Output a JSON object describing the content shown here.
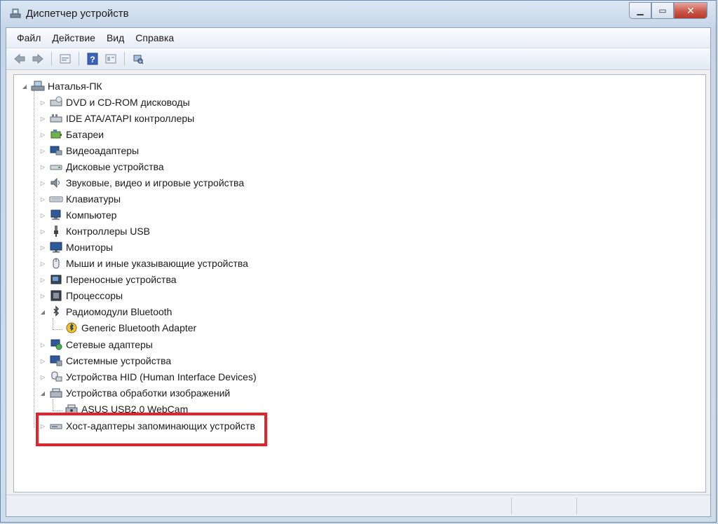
{
  "window": {
    "title": "Диспетчер устройств",
    "minimize_glyph": "▁",
    "maximize_glyph": "▭",
    "close_glyph": "✕"
  },
  "menu": {
    "items": [
      "Файл",
      "Действие",
      "Вид",
      "Справка"
    ]
  },
  "toolbar": {
    "buttons": [
      "back-arrow-icon",
      "forward-arrow-icon",
      "properties-icon",
      "help-icon",
      "view-icon",
      "scan-hardware-icon"
    ]
  },
  "tree": {
    "root": "Наталья-ПК",
    "items": [
      {
        "label": "DVD и CD-ROM дисководы",
        "icon": "dvd-drive-icon",
        "expanded": false
      },
      {
        "label": "IDE ATA/ATAPI контроллеры",
        "icon": "ide-controller-icon",
        "expanded": false
      },
      {
        "label": "Батареи",
        "icon": "battery-icon",
        "expanded": false
      },
      {
        "label": "Видеоадаптеры",
        "icon": "display-adapter-icon",
        "expanded": false
      },
      {
        "label": "Дисковые устройства",
        "icon": "disk-drive-icon",
        "expanded": false
      },
      {
        "label": "Звуковые, видео и игровые устройства",
        "icon": "sound-icon",
        "expanded": false
      },
      {
        "label": "Клавиатуры",
        "icon": "keyboard-icon",
        "expanded": false
      },
      {
        "label": "Компьютер",
        "icon": "computer-icon",
        "expanded": false
      },
      {
        "label": "Контроллеры USB",
        "icon": "usb-icon",
        "expanded": false
      },
      {
        "label": "Мониторы",
        "icon": "monitor-icon",
        "expanded": false
      },
      {
        "label": "Мыши и иные указывающие устройства",
        "icon": "mouse-icon",
        "expanded": false
      },
      {
        "label": "Переносные устройства",
        "icon": "portable-device-icon",
        "expanded": false
      },
      {
        "label": "Процессоры",
        "icon": "processor-icon",
        "expanded": false
      },
      {
        "label": "Радиомодули Bluetooth",
        "icon": "bluetooth-icon",
        "expanded": true,
        "children": [
          {
            "label": "Generic Bluetooth Adapter",
            "icon": "bluetooth-adapter-icon"
          }
        ]
      },
      {
        "label": "Сетевые адаптеры",
        "icon": "network-adapter-icon",
        "expanded": false
      },
      {
        "label": "Системные устройства",
        "icon": "system-device-icon",
        "expanded": false
      },
      {
        "label": "Устройства HID (Human Interface Devices)",
        "icon": "hid-icon",
        "expanded": false
      },
      {
        "label": "Устройства обработки изображений",
        "icon": "imaging-device-icon",
        "expanded": true,
        "children": [
          {
            "label": "ASUS USB2.0 WebCam",
            "icon": "webcam-icon"
          }
        ]
      },
      {
        "label": "Хост-адаптеры запоминающих устройств",
        "icon": "storage-controller-icon",
        "expanded": false
      }
    ]
  },
  "colors": {
    "highlight_border": "#e8202a",
    "title_bar": "#c6d6e8",
    "close_button": "#c9584a"
  }
}
